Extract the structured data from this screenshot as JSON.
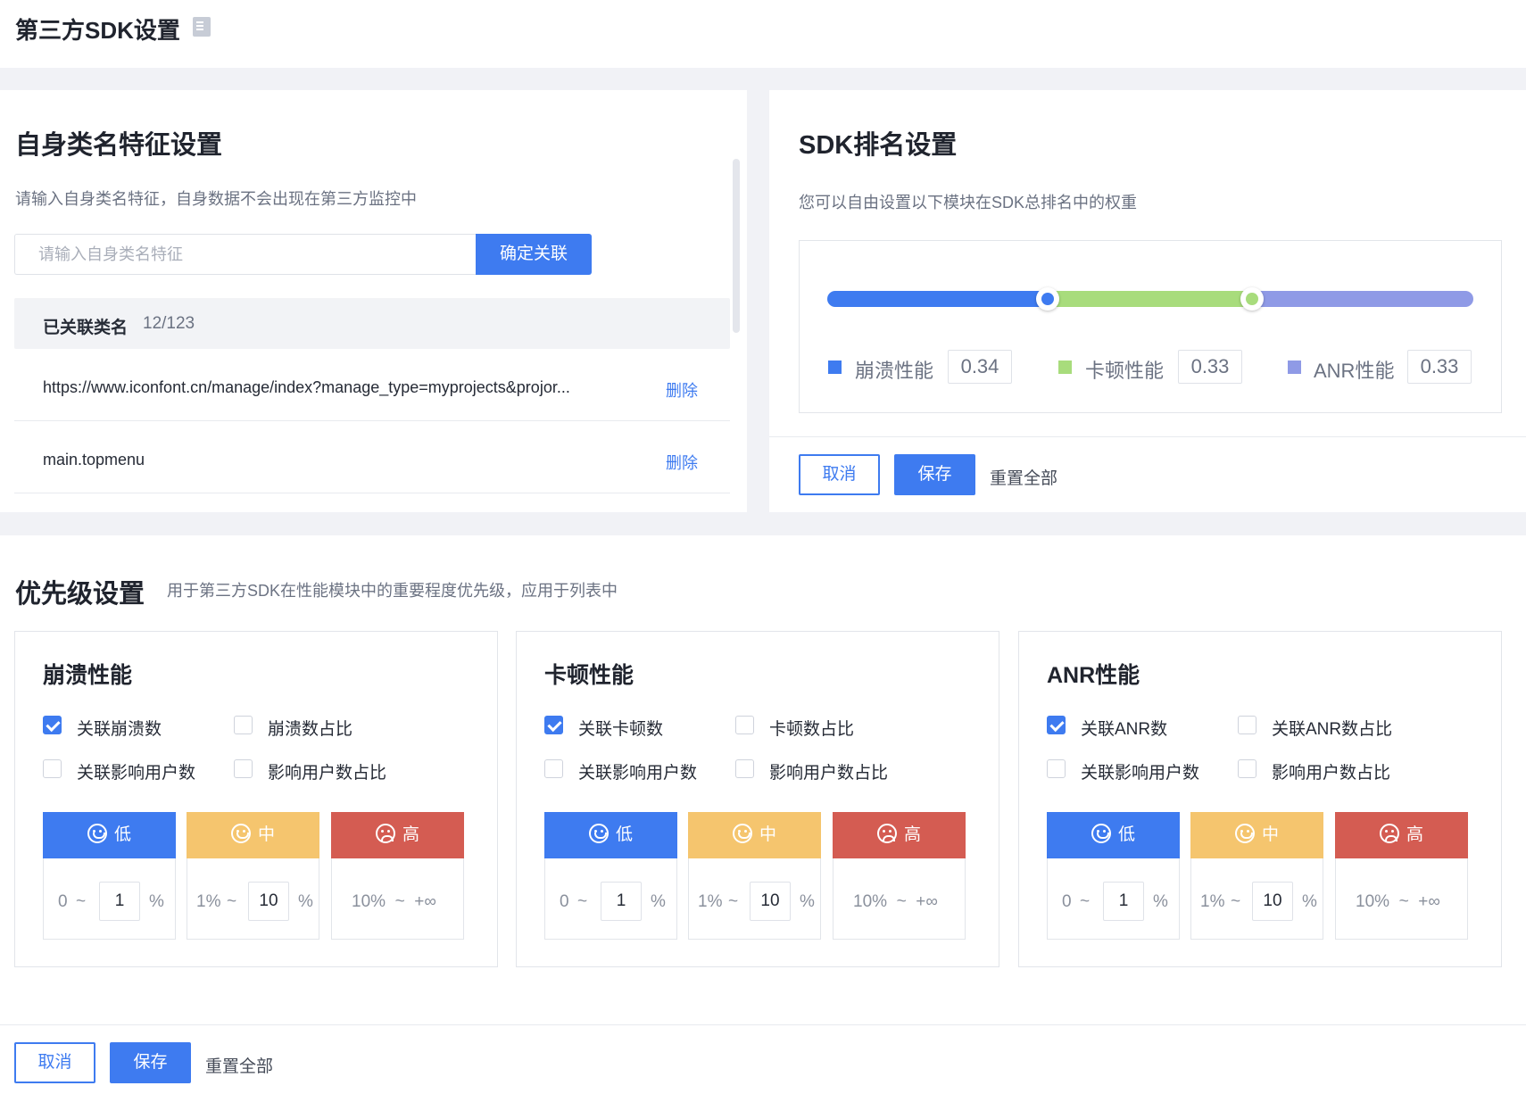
{
  "page": {
    "title": "第三方SDK设置",
    "doc_icon": "doc-icon"
  },
  "self_class": {
    "title": "自身类名特征设置",
    "desc": "请输入自身类名特征，自身数据不会出现在第三方监控中",
    "placeholder": "请输入自身类名特征",
    "input_value": "",
    "confirm_label": "确定关联",
    "assoc_label": "已关联类名",
    "assoc_count": "12/123",
    "rows": [
      {
        "text": "https://www.iconfont.cn/manage/index?manage_type=myprojects&projor...",
        "action": "删除"
      },
      {
        "text": "main.topmenu",
        "action": "删除"
      }
    ]
  },
  "sdk_rank": {
    "title": "SDK排名设置",
    "desc": "您可以自由设置以下模块在SDK总排名中的权重",
    "weights": [
      {
        "label": "崩溃性能",
        "value": "0.34",
        "color": "#3e7bf0"
      },
      {
        "label": "卡顿性能",
        "value": "0.33",
        "color": "#a8dc7c"
      },
      {
        "label": "ANR性能",
        "value": "0.33",
        "color": "#8f9ae6"
      }
    ],
    "cancel": "取消",
    "save": "保存",
    "reset": "重置全部"
  },
  "priority": {
    "title": "优先级设置",
    "desc": "用于第三方SDK在性能模块中的重要程度优先级，应用于列表中",
    "level_colors": {
      "low": "#3e7bf0",
      "mid": "#f5c56e",
      "high": "#d45c52"
    },
    "panels": [
      {
        "title": "崩溃性能",
        "checks": [
          {
            "label": "关联崩溃数",
            "checked": true
          },
          {
            "label": "崩溃数占比",
            "checked": false
          },
          {
            "label": "关联影响用户数",
            "checked": false
          },
          {
            "label": "影响用户数占比",
            "checked": false
          }
        ],
        "levels": {
          "low": {
            "label": "低",
            "start": "0",
            "sep": "~",
            "value": "1",
            "unit": "%"
          },
          "mid": {
            "label": "中",
            "start": "1%",
            "sep": "~",
            "value": "10",
            "unit": "%"
          },
          "high": {
            "label": "高",
            "range": "10%  ~  +∞"
          }
        }
      },
      {
        "title": "卡顿性能",
        "checks": [
          {
            "label": "关联卡顿数",
            "checked": true
          },
          {
            "label": "卡顿数占比",
            "checked": false
          },
          {
            "label": "关联影响用户数",
            "checked": false
          },
          {
            "label": "影响用户数占比",
            "checked": false
          }
        ],
        "levels": {
          "low": {
            "label": "低",
            "start": "0",
            "sep": "~",
            "value": "1",
            "unit": "%"
          },
          "mid": {
            "label": "中",
            "start": "1%",
            "sep": "~",
            "value": "10",
            "unit": "%"
          },
          "high": {
            "label": "高",
            "range": "10%  ~  +∞"
          }
        }
      },
      {
        "title": "ANR性能",
        "checks": [
          {
            "label": "关联ANR数",
            "checked": true
          },
          {
            "label": "关联ANR数占比",
            "checked": false
          },
          {
            "label": "关联影响用户数",
            "checked": false
          },
          {
            "label": "影响用户数占比",
            "checked": false
          }
        ],
        "levels": {
          "low": {
            "label": "低",
            "start": "0",
            "sep": "~",
            "value": "1",
            "unit": "%"
          },
          "mid": {
            "label": "中",
            "start": "1%",
            "sep": "~",
            "value": "10",
            "unit": "%"
          },
          "high": {
            "label": "高",
            "range": "10%  ~  +∞"
          }
        }
      }
    ],
    "cancel": "取消",
    "save": "保存",
    "reset": "重置全部"
  }
}
